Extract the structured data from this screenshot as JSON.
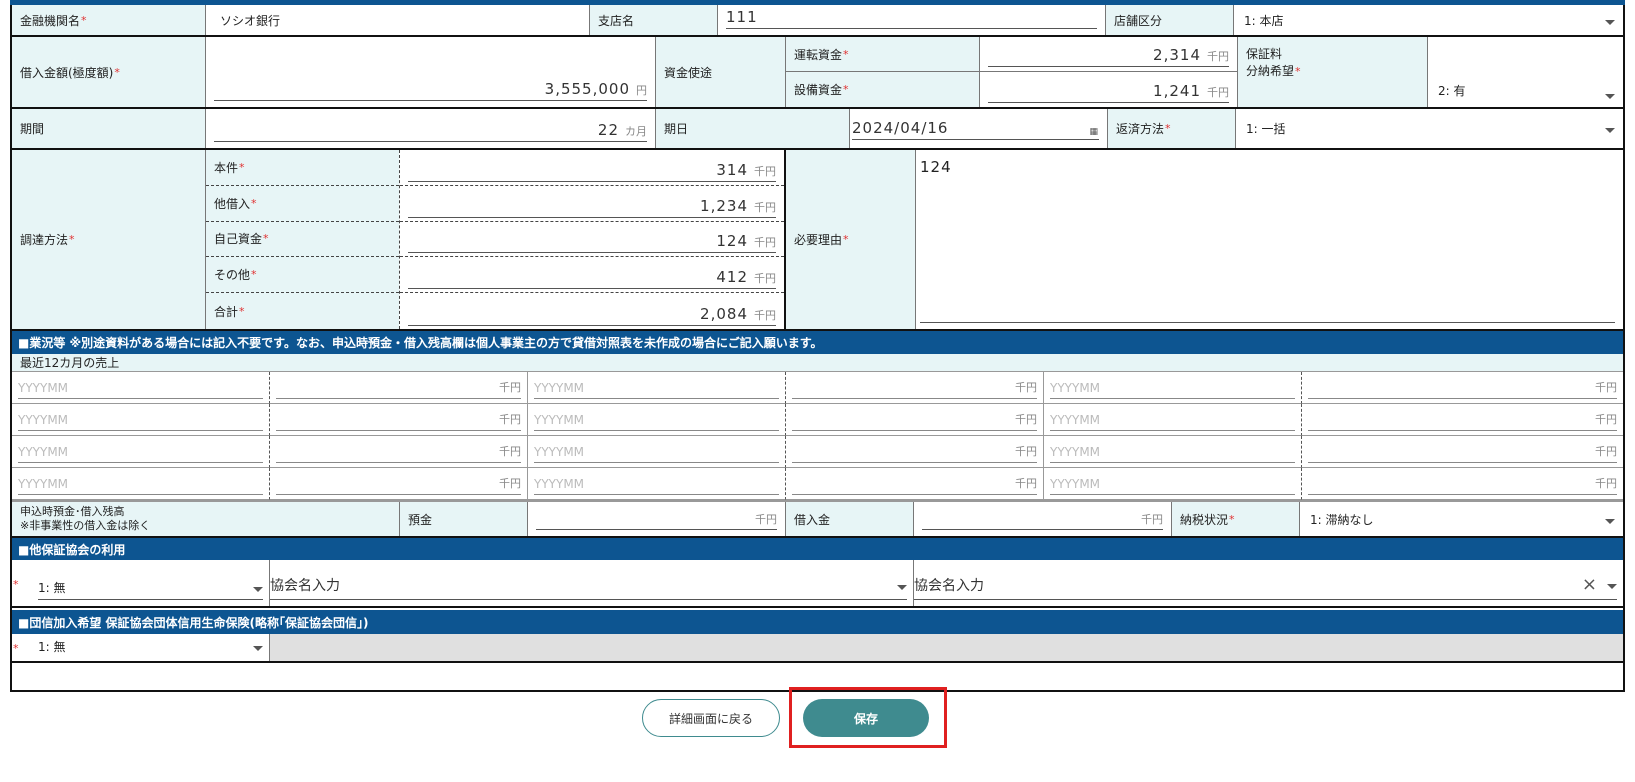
{
  "row1": {
    "bank_label": "金融機関名",
    "bank_value": "ソシオ銀行",
    "branch_label": "支店名",
    "branch_value": "111",
    "store_type_label": "店舗区分",
    "store_type_value": "1: 本店"
  },
  "row2": {
    "loan_label": "借入金額(極度額)",
    "loan_value": "3,555,000",
    "loan_unit": "円",
    "purpose_label": "資金使途",
    "working_label": "運転資金",
    "working_value": "2,314",
    "working_unit": "千円",
    "equipment_label": "設備資金",
    "equipment_value": "1,241",
    "equipment_unit": "千円",
    "guarantee_label_1": "保証料",
    "guarantee_label_2": "分納希望",
    "guarantee_value": "2: 有"
  },
  "row3": {
    "period_label": "期間",
    "period_value": "22",
    "period_unit": "カ月",
    "due_label": "期日",
    "due_value": "2024/04/16",
    "repay_label": "返済方法",
    "repay_value": "1: 一括"
  },
  "funding": {
    "label": "調達方法",
    "items": [
      {
        "label": "本件",
        "value": "314",
        "unit": "千円"
      },
      {
        "label": "他借入",
        "value": "1,234",
        "unit": "千円"
      },
      {
        "label": "自己資金",
        "value": "124",
        "unit": "千円"
      },
      {
        "label": "その他",
        "value": "412",
        "unit": "千円"
      },
      {
        "label": "合計",
        "value": "2,084",
        "unit": "千円"
      }
    ],
    "reason_label": "必要理由",
    "reason_value": "124"
  },
  "business": {
    "header": "■業況等 ※別途資料がある場合には記入不要です。なお、申込時預金・借入残高欄は個人事業主の方で貸借対照表を未作成の場合にご記入願います。",
    "sales_label": "最近12カ月の売上",
    "month_placeholder": "YYYYMM",
    "amount_unit": "千円",
    "balance_label_1": "申込時預金･借入残高",
    "balance_label_2": "※非事業性の借入金は除く",
    "deposit_label": "預金",
    "deposit_unit": "千円",
    "borrow_label": "借入金",
    "borrow_unit": "千円",
    "tax_label": "納税状況",
    "tax_value": "1: 滞納なし"
  },
  "other_assoc": {
    "header": "■他保証協会の利用",
    "use_value": "1: 無",
    "assoc1_placeholder": "協会名入力",
    "assoc2_placeholder": "協会名入力",
    "clear_glyph": "×"
  },
  "group_insurance": {
    "header": "■団信加入希望 保証協会団体信用生命保険(略称｢保証協会団信｣)",
    "value": "1: 無"
  },
  "required_mark": "*",
  "buttons": {
    "back_label": "詳細画面に戻る",
    "save_label": "保存"
  },
  "colors": {
    "header_band": "#0d5591",
    "label_bg": "#e7f5f6",
    "save_button": "#3f8b8f",
    "highlight": "#e02020"
  }
}
